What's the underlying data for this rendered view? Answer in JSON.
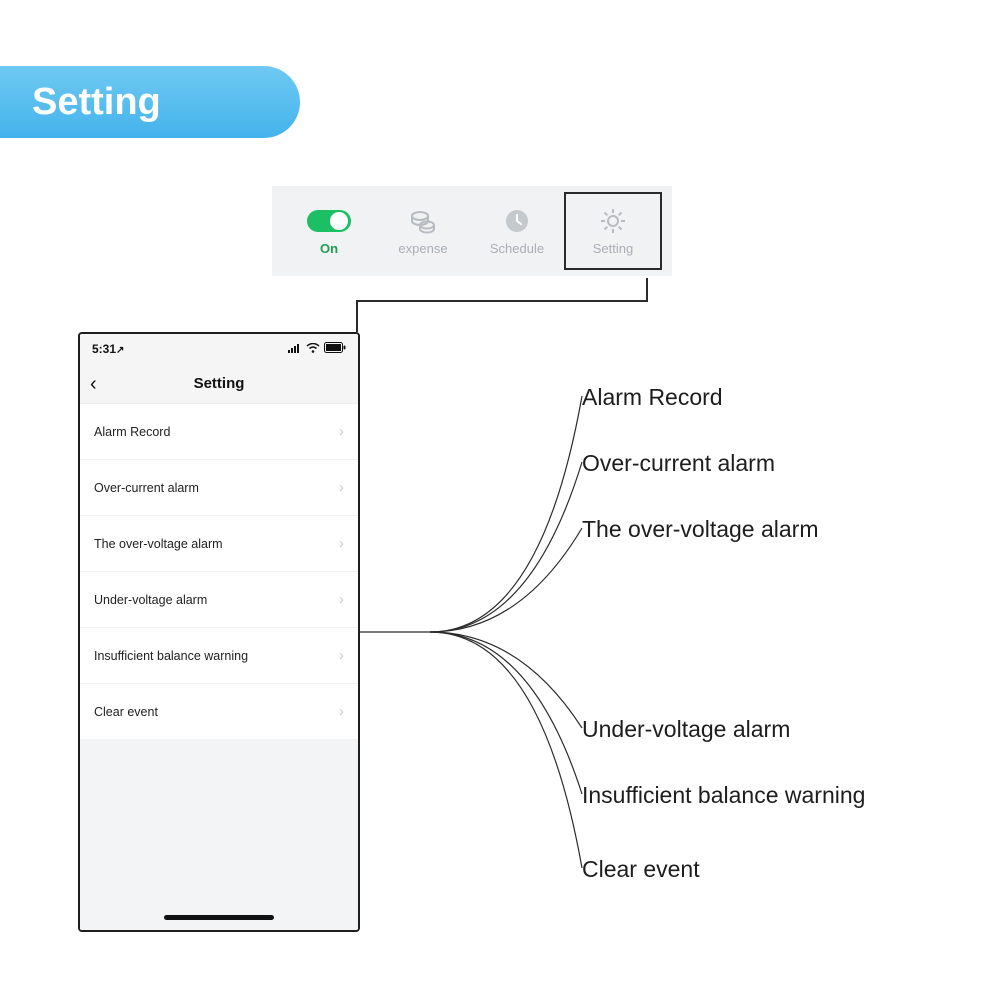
{
  "title": "Setting",
  "tabs": [
    {
      "label": "On"
    },
    {
      "label": "expense"
    },
    {
      "label": "Schedule"
    },
    {
      "label": "Setting"
    }
  ],
  "phone": {
    "time": "5:31",
    "nav_title": "Setting",
    "rows": [
      "Alarm Record",
      "Over-current alarm",
      "The over-voltage alarm",
      "Under-voltage alarm",
      "Insufficient balance warning",
      "Clear event"
    ]
  },
  "callouts": [
    "Alarm Record",
    "Over-current alarm",
    "The over-voltage alarm",
    "Under-voltage alarm",
    "Insufficient balance warning",
    "Clear event"
  ]
}
